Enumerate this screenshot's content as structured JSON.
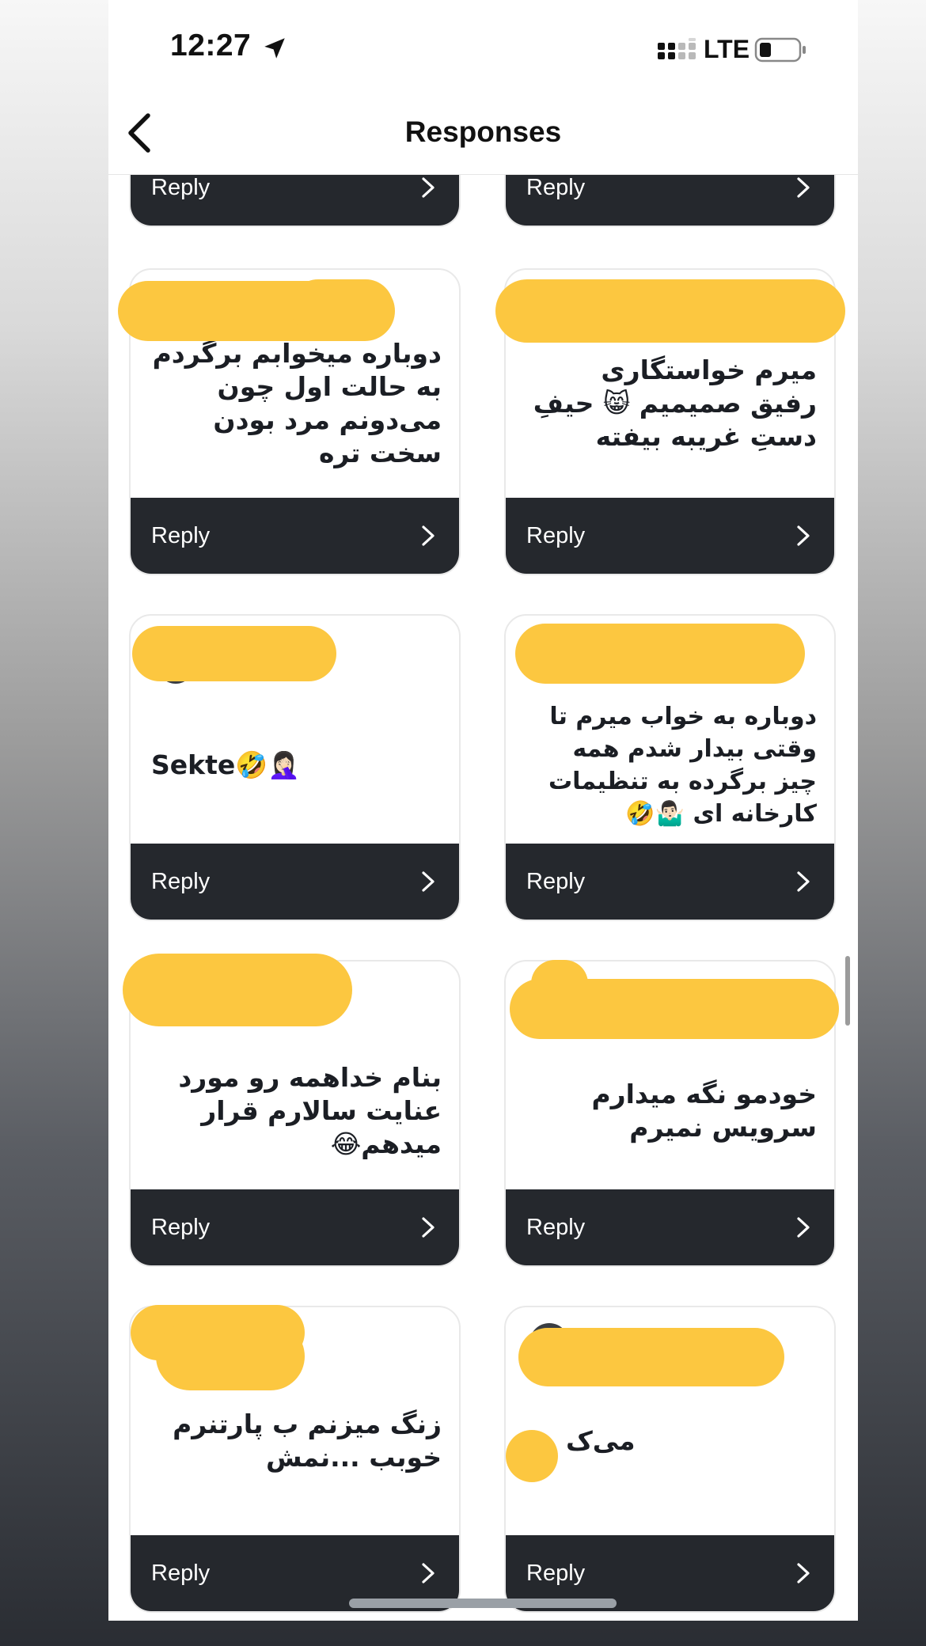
{
  "status_bar": {
    "time": "12:27",
    "network": "LTE",
    "location_icon": "location-arrow-icon",
    "signal_icon": "signal-bars-icon",
    "battery_icon": "battery-low-icon"
  },
  "nav": {
    "title": "Responses",
    "back_icon": "chevron-left-icon"
  },
  "colors": {
    "reply_bar": "#25282d",
    "redaction": "#fcc740",
    "card_border": "#e9e9e9"
  },
  "reply_icon": "chevron-right-icon",
  "cards": [
    {
      "text": "",
      "reply_label": "Reply"
    },
    {
      "text": "",
      "reply_label": "Reply"
    },
    {
      "text": "دوباره میخوابم برگردم به حالت اول چون می‌دونم مرد بودن سخت تره",
      "reply_label": "Reply"
    },
    {
      "text": "میرم خواستگاری رفیق صمیمیم 😸 حیفِ دستِ غریبه بیفته",
      "reply_label": "Reply"
    },
    {
      "text": "Sekte🤣🤦🏻‍♀️",
      "reply_label": "Reply"
    },
    {
      "text": "دوباره به خواب میرم تا وقتی بیدار شدم همه چیز برگرده به تنظیمات کارخانه ای 🤷🏻‍♂️🤣",
      "reply_label": "Reply"
    },
    {
      "text": "بنام خداهمه رو مورد عنایت سالارم قرار میدهم😂",
      "reply_label": "Reply"
    },
    {
      "text": "خودمو نگه میدارم سرویس نمیرم",
      "reply_label": "Reply"
    },
    {
      "text": "زنگ میزنم ب پارتنرم خوبب ...نمش",
      "reply_label": "Reply"
    },
    {
      "text": "می‌ک",
      "reply_label": "Reply"
    }
  ]
}
